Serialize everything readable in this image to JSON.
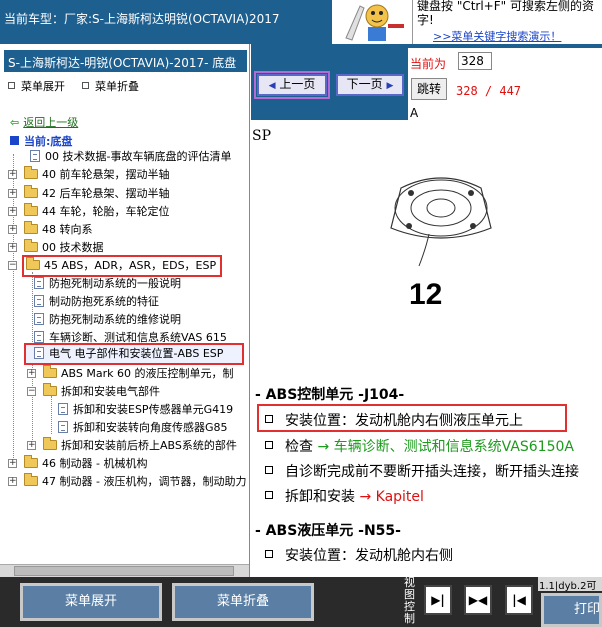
{
  "header": {
    "car_title": "当前车型：厂家:S-上海斯柯达明锐(OCTAVIA)2017",
    "tip_line1": "键盘按 \"Ctrl+F\" 可搜索左侧的资",
    "tip_line2": "字!",
    "tip_link": ">>菜单关键字搜索演示！"
  },
  "left_panel": {
    "title": "S-上海斯柯达-明锐(OCTAVIA)-2017- 底盘",
    "expand_label": "菜单展开",
    "collapse_label": "菜单折叠",
    "back_label": "返回上一级",
    "current_label": "当前:底盘",
    "tree": [
      {
        "label": "00 技术数据-事故车辆底盘的评估清单",
        "type": "doc"
      },
      {
        "label": "40 前车轮悬架，摆动半轴",
        "type": "folder"
      },
      {
        "label": "42 后车轮悬架、摆动半轴",
        "type": "folder"
      },
      {
        "label": "44 车轮，轮胎，车轮定位",
        "type": "folder"
      },
      {
        "label": "48 转向系",
        "type": "folder"
      },
      {
        "label": "00 技术数据",
        "type": "folder"
      },
      {
        "label": "45 ABS，ADR，ASR，EDS，ESP",
        "type": "folder-open"
      },
      {
        "label": "防抱死制动系统的一般说明",
        "type": "doc"
      },
      {
        "label": "制动防抱死系统的特征",
        "type": "doc"
      },
      {
        "label": "防抱死制动系统的维修说明",
        "type": "doc"
      },
      {
        "label": "车辆诊断、测试和信息系统VAS 615",
        "type": "doc"
      },
      {
        "label": "电气 电子部件和安装位置-ABS ESP",
        "type": "doc"
      },
      {
        "label": "ABS Mark 60 的液压控制单元，制",
        "type": "folder"
      },
      {
        "label": "拆卸和安装电气部件",
        "type": "folder-open"
      },
      {
        "label": "拆卸和安装ESP传感器单元G419",
        "type": "doc"
      },
      {
        "label": "拆卸和安装转向角度传感器G85",
        "type": "doc"
      },
      {
        "label": "拆卸和安装前后桥上ABS系统的部件",
        "type": "folder"
      },
      {
        "label": "46 制动器 - 机械机构",
        "type": "folder"
      },
      {
        "label": "47 制动器 - 液压机构，调节器，制动助力",
        "type": "folder"
      }
    ]
  },
  "pager": {
    "prev_label": "上一页",
    "next_label": "下一页",
    "current_page_label": "当前为",
    "page_input": "328",
    "jump_label": "跳转",
    "page_count": "328 / 447",
    "a_label": "A"
  },
  "document": {
    "section_code": "SP",
    "figure_number": "12",
    "heading1": "- ABS控制单元 -J104-",
    "b1": "安装位置：发动机舱内右侧液压单元上",
    "b2_prefix": "检查",
    "b2_link": "→ 车辆诊断、测试和信息系统VAS6150A",
    "b3": "自诊断完成前不要断开插头连接，断开插头连接",
    "b4_prefix": "拆卸和安装",
    "b4_link": "→ Kapitel",
    "heading2": "- ABS液压单元 -N55-",
    "b5": "安装位置：发动机舱内右侧"
  },
  "footer": {
    "expand_label": "菜单展开",
    "collapse_label": "菜单折叠",
    "view_label": "视图控制",
    "status_text": "1.1|dyb.2可",
    "print_label": "打印"
  },
  "colors": {
    "header_blue": "#1d5f8f",
    "highlight_red": "#e03030",
    "link_green": "#1d9a1d",
    "counter_red": "#e01010"
  }
}
